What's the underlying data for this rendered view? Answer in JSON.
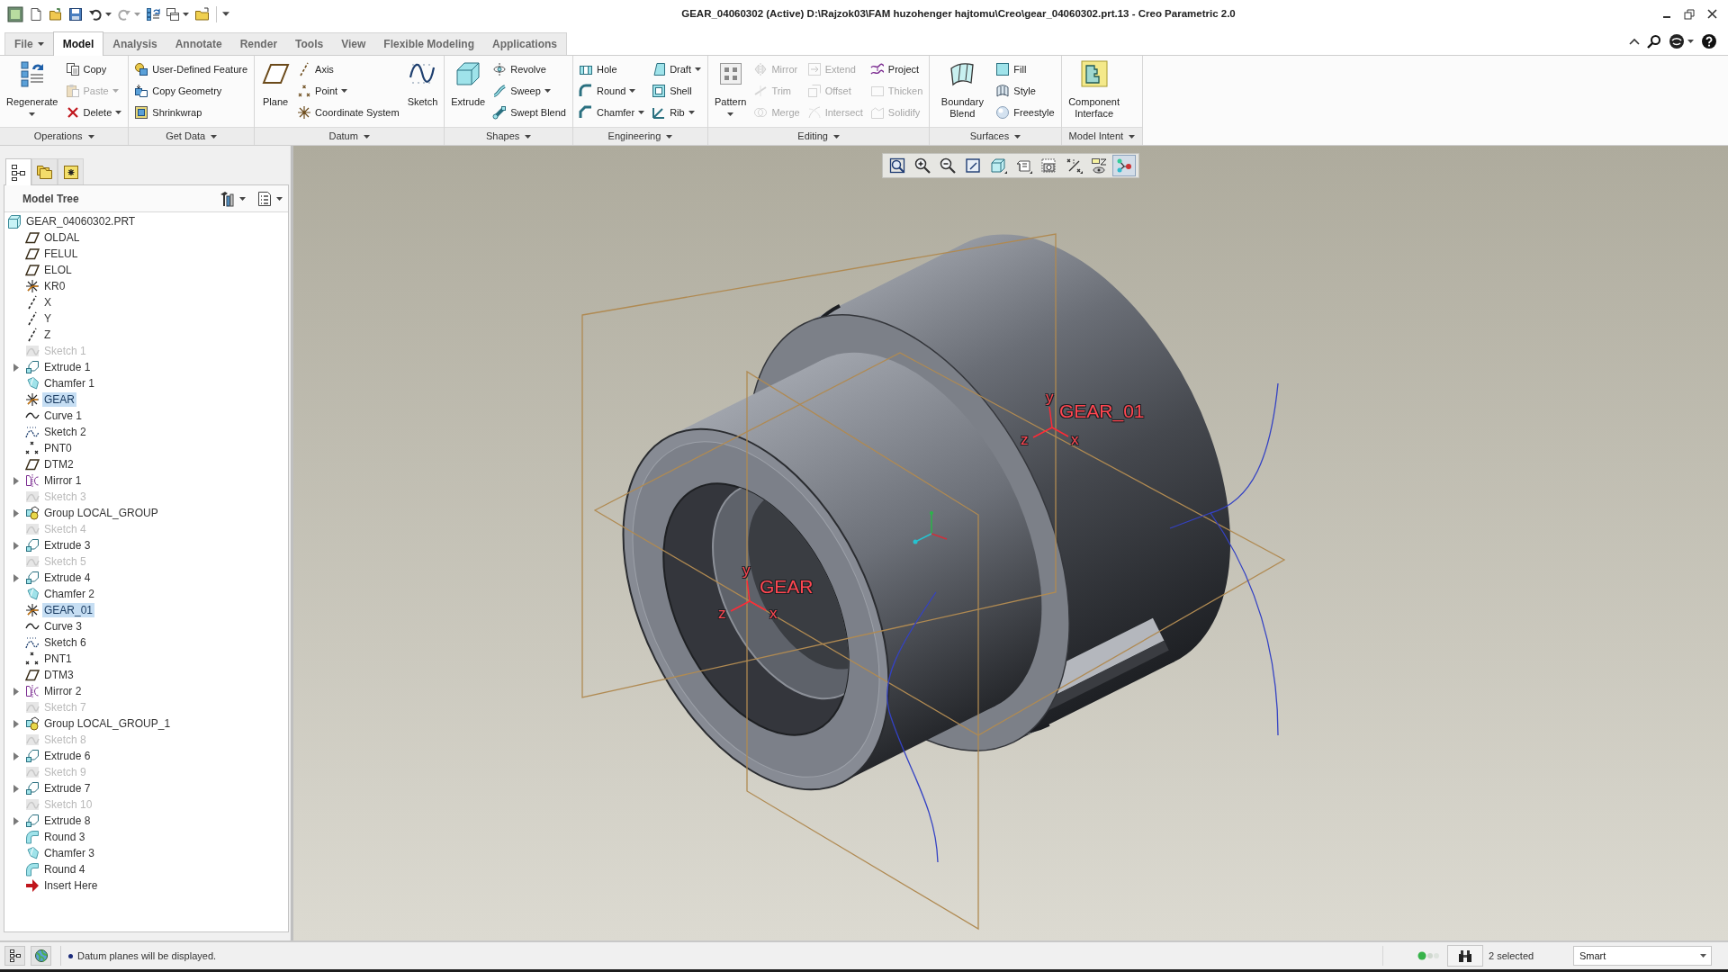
{
  "window": {
    "title": "GEAR_04060302 (Active) D:\\Rajzok03\\FAM huzohenger hajtomu\\Creo\\gear_04060302.prt.13 - Creo Parametric 2.0"
  },
  "tabs": [
    {
      "label": "File",
      "kind": "menu",
      "selected": false
    },
    {
      "label": "Model",
      "kind": "tab",
      "selected": true
    },
    {
      "label": "Analysis",
      "kind": "tab",
      "selected": false
    },
    {
      "label": "Annotate",
      "kind": "tab",
      "selected": false
    },
    {
      "label": "Render",
      "kind": "tab",
      "selected": false
    },
    {
      "label": "Tools",
      "kind": "tab",
      "selected": false
    },
    {
      "label": "View",
      "kind": "tab",
      "selected": false
    },
    {
      "label": "Flexible Modeling",
      "kind": "tab",
      "selected": false
    },
    {
      "label": "Applications",
      "kind": "tab",
      "selected": false
    }
  ],
  "ribbon": {
    "groups": [
      {
        "label": "Operations",
        "columns": [
          {
            "kind": "large",
            "buttons": [
              {
                "label": "Regenerate",
                "disabled": false,
                "dropdown": true
              }
            ]
          },
          {
            "kind": "small",
            "buttons": [
              {
                "label": "Copy",
                "disabled": false,
                "dropdown": false
              },
              {
                "label": "Paste",
                "disabled": true,
                "dropdown": true
              },
              {
                "label": "Delete",
                "disabled": false,
                "dropdown": true
              }
            ]
          }
        ]
      },
      {
        "label": "Get Data",
        "columns": [
          {
            "kind": "small",
            "buttons": [
              {
                "label": "User-Defined Feature",
                "disabled": false,
                "dropdown": false
              },
              {
                "label": "Copy Geometry",
                "disabled": false,
                "dropdown": false
              },
              {
                "label": "Shrinkwrap",
                "disabled": false,
                "dropdown": false
              }
            ]
          }
        ]
      },
      {
        "label": "Datum",
        "columns": [
          {
            "kind": "large",
            "buttons": [
              {
                "label": "Plane",
                "disabled": false,
                "dropdown": false
              }
            ]
          },
          {
            "kind": "small",
            "buttons": [
              {
                "label": "Axis",
                "disabled": false,
                "dropdown": false
              },
              {
                "label": "Point",
                "disabled": false,
                "dropdown": true
              },
              {
                "label": "Coordinate System",
                "disabled": false,
                "dropdown": false
              }
            ]
          },
          {
            "kind": "large",
            "buttons": [
              {
                "label": "Sketch",
                "disabled": false,
                "dropdown": false
              }
            ]
          }
        ]
      },
      {
        "label": "Shapes",
        "columns": [
          {
            "kind": "large",
            "buttons": [
              {
                "label": "Extrude",
                "disabled": false,
                "dropdown": false
              }
            ]
          },
          {
            "kind": "small",
            "buttons": [
              {
                "label": "Revolve",
                "disabled": false,
                "dropdown": false
              },
              {
                "label": "Sweep",
                "disabled": false,
                "dropdown": true
              },
              {
                "label": "Swept Blend",
                "disabled": false,
                "dropdown": false
              }
            ]
          }
        ]
      },
      {
        "label": "Engineering",
        "columns": [
          {
            "kind": "small",
            "buttons": [
              {
                "label": "Hole",
                "disabled": false,
                "dropdown": false
              },
              {
                "label": "Round",
                "disabled": false,
                "dropdown": true
              },
              {
                "label": "Chamfer",
                "disabled": false,
                "dropdown": true
              }
            ]
          },
          {
            "kind": "small",
            "buttons": [
              {
                "label": "Draft",
                "disabled": false,
                "dropdown": true
              },
              {
                "label": "Shell",
                "disabled": false,
                "dropdown": false
              },
              {
                "label": "Rib",
                "disabled": false,
                "dropdown": true
              }
            ]
          }
        ]
      },
      {
        "label": "Editing",
        "columns": [
          {
            "kind": "large",
            "buttons": [
              {
                "label": "Pattern",
                "disabled": false,
                "dropdown": true
              }
            ]
          },
          {
            "kind": "small",
            "buttons": [
              {
                "label": "Mirror",
                "disabled": true,
                "dropdown": false
              },
              {
                "label": "Trim",
                "disabled": true,
                "dropdown": false
              },
              {
                "label": "Merge",
                "disabled": true,
                "dropdown": false
              }
            ]
          },
          {
            "kind": "small",
            "buttons": [
              {
                "label": "Extend",
                "disabled": true,
                "dropdown": false
              },
              {
                "label": "Offset",
                "disabled": true,
                "dropdown": false
              },
              {
                "label": "Intersect",
                "disabled": true,
                "dropdown": false
              }
            ]
          },
          {
            "kind": "small",
            "buttons": [
              {
                "label": "Project",
                "disabled": false,
                "dropdown": false
              },
              {
                "label": "Thicken",
                "disabled": true,
                "dropdown": false
              },
              {
                "label": "Solidify",
                "disabled": true,
                "dropdown": false
              }
            ]
          }
        ]
      },
      {
        "label": "Surfaces",
        "columns": [
          {
            "kind": "large",
            "buttons": [
              {
                "label": "Boundary Blend",
                "disabled": false,
                "dropdown": false
              }
            ]
          },
          {
            "kind": "small",
            "buttons": [
              {
                "label": "Fill",
                "disabled": false,
                "dropdown": false
              },
              {
                "label": "Style",
                "disabled": false,
                "dropdown": false
              },
              {
                "label": "Freestyle",
                "disabled": false,
                "dropdown": false
              }
            ]
          }
        ]
      },
      {
        "label": "Model Intent",
        "columns": [
          {
            "kind": "large",
            "buttons": [
              {
                "label": "Component Interface",
                "disabled": false,
                "dropdown": false
              }
            ]
          }
        ]
      }
    ]
  },
  "navigator_tabs": [
    {
      "selected": true
    },
    {
      "selected": false
    },
    {
      "selected": false
    }
  ],
  "model_tree": {
    "title": "Model Tree",
    "root": {
      "label": "GEAR_04060302.PRT",
      "kind": "part",
      "selected": false,
      "children": [
        {
          "label": "OLDAL",
          "kind": "plane",
          "dimmed": false,
          "expandable": false,
          "selected": false
        },
        {
          "label": "FELUL",
          "kind": "plane",
          "dimmed": false,
          "expandable": false,
          "selected": false
        },
        {
          "label": "ELOL",
          "kind": "plane",
          "dimmed": false,
          "expandable": false,
          "selected": false
        },
        {
          "label": "KR0",
          "kind": "csys",
          "dimmed": false,
          "expandable": false,
          "selected": false
        },
        {
          "label": "X",
          "kind": "axis",
          "dimmed": false,
          "expandable": false,
          "selected": false
        },
        {
          "label": "Y",
          "kind": "axis",
          "dimmed": false,
          "expandable": false,
          "selected": false
        },
        {
          "label": "Z",
          "kind": "axis",
          "dimmed": false,
          "expandable": false,
          "selected": false
        },
        {
          "label": "Sketch 1",
          "kind": "sketch",
          "dimmed": true,
          "expandable": false,
          "selected": false
        },
        {
          "label": "Extrude 1",
          "kind": "extrude",
          "dimmed": false,
          "expandable": true,
          "selected": false
        },
        {
          "label": "Chamfer 1",
          "kind": "chamfer",
          "dimmed": false,
          "expandable": false,
          "selected": false
        },
        {
          "label": "GEAR",
          "kind": "csys",
          "dimmed": false,
          "expandable": false,
          "selected": true
        },
        {
          "label": "Curve 1",
          "kind": "curve",
          "dimmed": false,
          "expandable": false,
          "selected": false
        },
        {
          "label": "Sketch 2",
          "kind": "sketch",
          "dimmed": false,
          "expandable": false,
          "selected": false
        },
        {
          "label": "PNT0",
          "kind": "point",
          "dimmed": false,
          "expandable": false,
          "selected": false
        },
        {
          "label": "DTM2",
          "kind": "plane",
          "dimmed": false,
          "expandable": false,
          "selected": false
        },
        {
          "label": "Mirror 1",
          "kind": "mirror",
          "dimmed": false,
          "expandable": true,
          "selected": false
        },
        {
          "label": "Sketch 3",
          "kind": "sketch",
          "dimmed": true,
          "expandable": false,
          "selected": false
        },
        {
          "label": "Group LOCAL_GROUP",
          "kind": "group",
          "dimmed": false,
          "expandable": true,
          "selected": false
        },
        {
          "label": "Sketch 4",
          "kind": "sketch",
          "dimmed": true,
          "expandable": false,
          "selected": false
        },
        {
          "label": "Extrude 3",
          "kind": "extrude",
          "dimmed": false,
          "expandable": true,
          "selected": false
        },
        {
          "label": "Sketch 5",
          "kind": "sketch",
          "dimmed": true,
          "expandable": false,
          "selected": false
        },
        {
          "label": "Extrude 4",
          "kind": "extrude",
          "dimmed": false,
          "expandable": true,
          "selected": false
        },
        {
          "label": "Chamfer 2",
          "kind": "chamfer",
          "dimmed": false,
          "expandable": false,
          "selected": false
        },
        {
          "label": "GEAR_01",
          "kind": "csys",
          "dimmed": false,
          "expandable": false,
          "selected": true
        },
        {
          "label": "Curve 3",
          "kind": "curve",
          "dimmed": false,
          "expandable": false,
          "selected": false
        },
        {
          "label": "Sketch 6",
          "kind": "sketch",
          "dimmed": false,
          "expandable": false,
          "selected": false
        },
        {
          "label": "PNT1",
          "kind": "point",
          "dimmed": false,
          "expandable": false,
          "selected": false
        },
        {
          "label": "DTM3",
          "kind": "plane",
          "dimmed": false,
          "expandable": false,
          "selected": false
        },
        {
          "label": "Mirror 2",
          "kind": "mirror",
          "dimmed": false,
          "expandable": true,
          "selected": false
        },
        {
          "label": "Sketch 7",
          "kind": "sketch",
          "dimmed": true,
          "expandable": false,
          "selected": false
        },
        {
          "label": "Group LOCAL_GROUP_1",
          "kind": "group",
          "dimmed": false,
          "expandable": true,
          "selected": false
        },
        {
          "label": "Sketch 8",
          "kind": "sketch",
          "dimmed": true,
          "expandable": false,
          "selected": false
        },
        {
          "label": "Extrude 6",
          "kind": "extrude",
          "dimmed": false,
          "expandable": true,
          "selected": false
        },
        {
          "label": "Sketch 9",
          "kind": "sketch",
          "dimmed": true,
          "expandable": false,
          "selected": false
        },
        {
          "label": "Extrude 7",
          "kind": "extrude",
          "dimmed": false,
          "expandable": true,
          "selected": false
        },
        {
          "label": "Sketch 10",
          "kind": "sketch",
          "dimmed": true,
          "expandable": false,
          "selected": false
        },
        {
          "label": "Extrude 8",
          "kind": "extrude",
          "dimmed": false,
          "expandable": true,
          "selected": false
        },
        {
          "label": "Round 3",
          "kind": "round",
          "dimmed": false,
          "expandable": false,
          "selected": false
        },
        {
          "label": "Chamfer 3",
          "kind": "chamfer",
          "dimmed": false,
          "expandable": false,
          "selected": false
        },
        {
          "label": "Round 4",
          "kind": "round",
          "dimmed": false,
          "expandable": false,
          "selected": false
        },
        {
          "label": "Insert Here",
          "kind": "insert",
          "dimmed": false,
          "expandable": false,
          "selected": false
        }
      ]
    }
  },
  "view_toolbar": [
    {
      "on": false
    },
    {
      "on": false
    },
    {
      "on": false
    },
    {
      "on": false
    },
    {
      "on": false
    },
    {
      "on": false
    },
    {
      "on": false
    },
    {
      "on": false
    },
    {
      "on": false
    },
    {
      "on": true
    }
  ],
  "viewport": {
    "csys": [
      {
        "label": "GEAR_01",
        "axes": [
          "y",
          "z",
          "x"
        ]
      },
      {
        "label": "GEAR",
        "axes": [
          "y",
          "z",
          "x"
        ]
      }
    ]
  },
  "status_bar": {
    "message": "Datum planes will be displayed.",
    "selection": "2 selected",
    "filter": "Smart"
  }
}
